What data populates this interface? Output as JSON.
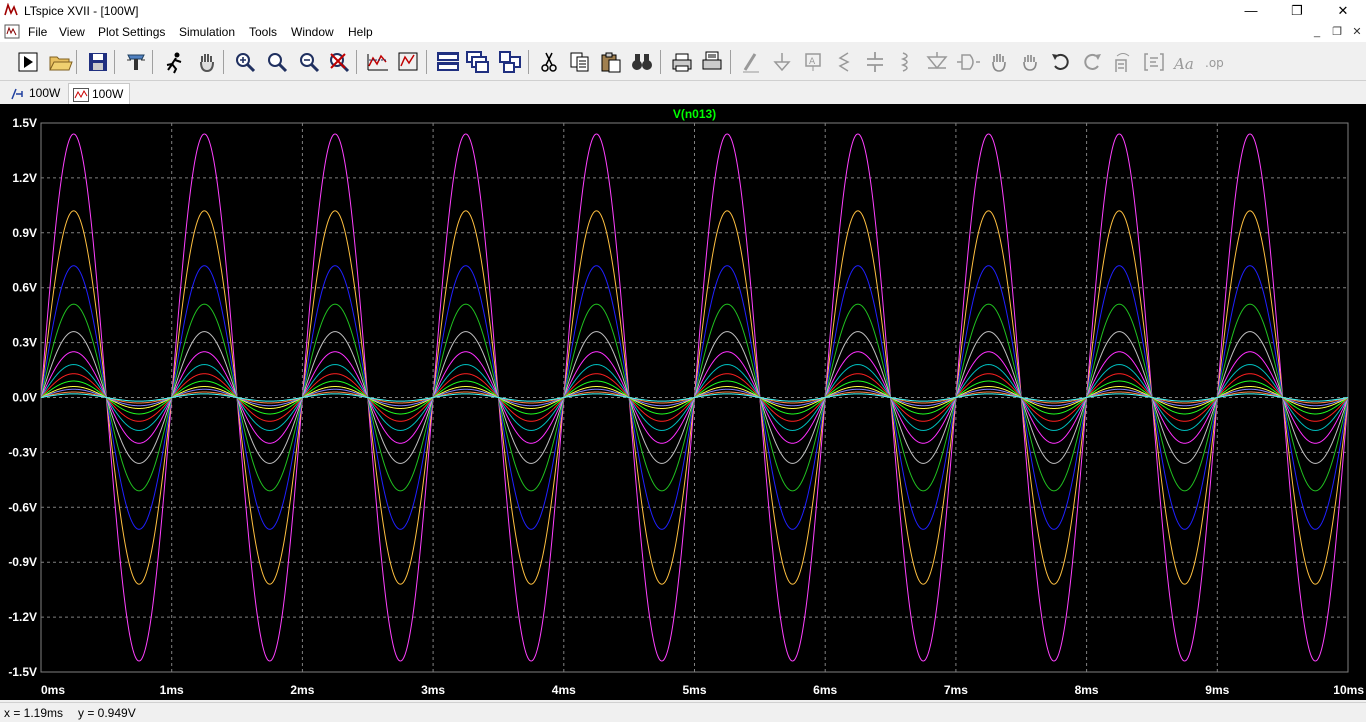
{
  "window": {
    "title": "LTspice XVII - [100W]",
    "minimize": "—",
    "restore": "❐",
    "close": "✕"
  },
  "menu": {
    "items": [
      "File",
      "View",
      "Plot Settings",
      "Simulation",
      "Tools",
      "Window",
      "Help"
    ],
    "mdi": {
      "minimize": "_",
      "restore": "❐",
      "close": "✕"
    }
  },
  "toolbar": {
    "buttons": [
      "run-icon",
      "open-icon",
      "save-icon",
      "control-panel-icon",
      "run-simulation-icon",
      "pan-hand-icon",
      "zoom-in-icon",
      "zoom-area-icon",
      "zoom-out-icon",
      "zoom-cancel-icon",
      "autorange-icon",
      "fit-icon",
      "tile-horizontal-icon",
      "cascade-icon",
      "tile-vertical-icon",
      "cut-icon",
      "copy-icon",
      "paste-icon",
      "find-icon",
      "print-icon",
      "print-setup-icon",
      "wire-icon",
      "ground-icon",
      "label-icon",
      "resistor-icon",
      "capacitor-icon",
      "inductor-icon",
      "diode-icon",
      "component-icon",
      "move-icon",
      "drag-icon",
      "undo-icon",
      "redo-icon",
      "rotate-icon",
      "mirror-icon",
      "text-icon",
      "spice-directive-icon"
    ]
  },
  "tabs": [
    {
      "label": "100W",
      "icon": "schematic-icon"
    },
    {
      "label": "100W",
      "icon": "waveform-icon"
    }
  ],
  "plot": {
    "trace_label": "V(n013)",
    "background": "#000000",
    "grid_color": "#808080",
    "trace_label_color": "#00ff00"
  },
  "chart_data": {
    "type": "line",
    "title": "V(n013)",
    "xlim": [
      0,
      10
    ],
    "ylim": [
      -1.5,
      1.5
    ],
    "grid": true,
    "x_ticks": [
      "0ms",
      "1ms",
      "2ms",
      "3ms",
      "4ms",
      "5ms",
      "6ms",
      "7ms",
      "8ms",
      "9ms",
      "10ms"
    ],
    "y_ticks": [
      "1.5V",
      "1.2V",
      "0.9V",
      "0.6V",
      "0.3V",
      "0.0V",
      "-0.3V",
      "-0.6V",
      "-0.9V",
      "-1.2V",
      "-1.5V"
    ],
    "waveform": "sine",
    "frequency_khz": 1.0,
    "series": [
      {
        "amplitude": 1.44,
        "color": "#ff40ff"
      },
      {
        "amplitude": 1.02,
        "color": "#ffc040"
      },
      {
        "amplitude": 0.72,
        "color": "#2020ff"
      },
      {
        "amplitude": 0.51,
        "color": "#20c020"
      },
      {
        "amplitude": 0.36,
        "color": "#c0c0c0"
      },
      {
        "amplitude": 0.25,
        "color": "#ff30ff"
      },
      {
        "amplitude": 0.18,
        "color": "#00c0c0"
      },
      {
        "amplitude": 0.13,
        "color": "#ff2020"
      },
      {
        "amplitude": 0.09,
        "color": "#20ff20"
      },
      {
        "amplitude": 0.06,
        "color": "#ffff40"
      },
      {
        "amplitude": 0.045,
        "color": "#8080ff"
      },
      {
        "amplitude": 0.03,
        "color": "#ff8040"
      },
      {
        "amplitude": 0.02,
        "color": "#40ffff"
      }
    ]
  },
  "status": {
    "cursor_x": "x = 1.19ms",
    "cursor_y": "y = 0.949V"
  }
}
